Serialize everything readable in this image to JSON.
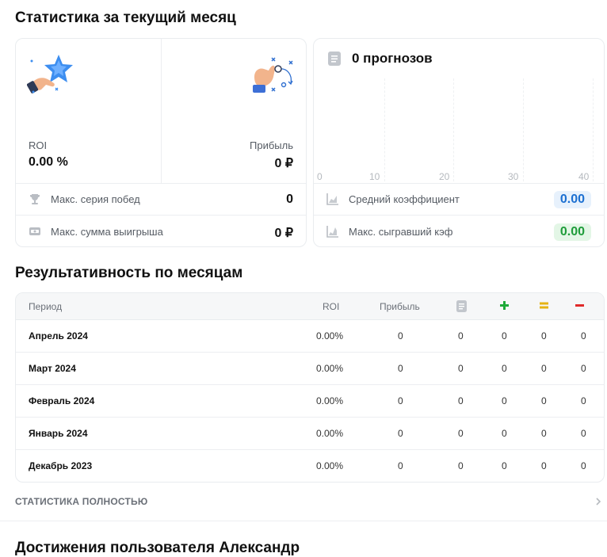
{
  "stats": {
    "title": "Статистика за текущий месяц",
    "roi_label": "ROI",
    "roi_value": "0.00 %",
    "profit_label": "Прибыль",
    "profit_value": "0 ₽",
    "max_win_streak_label": "Макс. серия побед",
    "max_win_streak_value": "0",
    "max_win_sum_label": "Макс. сумма выигрыша",
    "max_win_sum_value": "0 ₽"
  },
  "forecasts": {
    "title": "0 прогнозов",
    "axis_ticks": [
      "0",
      "10",
      "20",
      "30",
      "40"
    ],
    "avg_coef_label": "Средний коэффициент",
    "avg_coef_value": "0.00",
    "max_coef_label": "Макс. сыгравший кэф",
    "max_coef_value": "0.00"
  },
  "monthly": {
    "title": "Результативность по месяцам",
    "headers": {
      "period": "Период",
      "roi": "ROI",
      "profit": "Прибыль",
      "forecasts_icon": "document-icon",
      "wins_icon": "plus-icon",
      "draws_icon": "equals-icon",
      "losses_icon": "minus-icon"
    },
    "rows": [
      {
        "period": "Апрель 2024",
        "roi": "0.00%",
        "profit": "0",
        "forecasts": "0",
        "wins": "0",
        "draws": "0",
        "losses": "0"
      },
      {
        "period": "Март 2024",
        "roi": "0.00%",
        "profit": "0",
        "forecasts": "0",
        "wins": "0",
        "draws": "0",
        "losses": "0"
      },
      {
        "period": "Февраль 2024",
        "roi": "0.00%",
        "profit": "0",
        "forecasts": "0",
        "wins": "0",
        "draws": "0",
        "losses": "0"
      },
      {
        "period": "Январь 2024",
        "roi": "0.00%",
        "profit": "0",
        "forecasts": "0",
        "wins": "0",
        "draws": "0",
        "losses": "0"
      },
      {
        "period": "Декабрь 2023",
        "roi": "0.00%",
        "profit": "0",
        "forecasts": "0",
        "wins": "0",
        "draws": "0",
        "losses": "0"
      }
    ],
    "full_stats_link": "СТАТИСТИКА ПОЛНОСТЬЮ"
  },
  "achievements": {
    "title": "Достижения пользователя Александр"
  },
  "colors": {
    "plus": "#1faa3a",
    "equals": "#e6b312",
    "minus": "#e02a2a",
    "badge_blue": "#1b6fd1",
    "badge_green": "#1e9c3a"
  }
}
